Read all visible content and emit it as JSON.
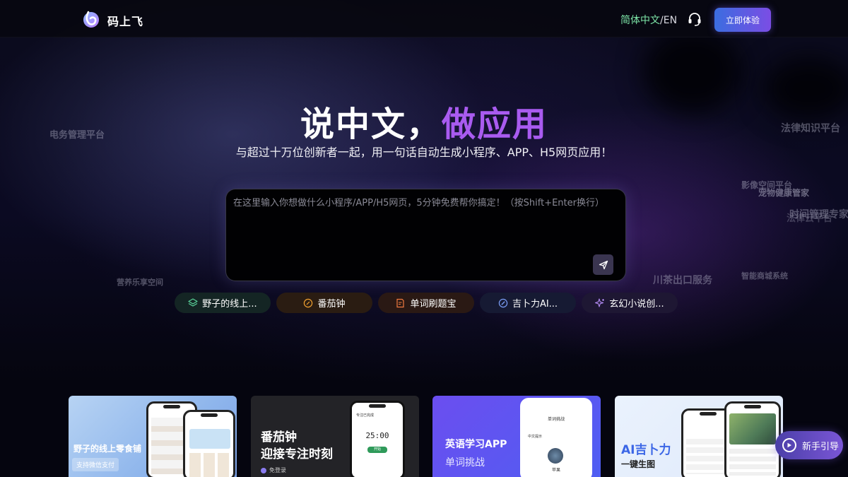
{
  "header": {
    "brand": "码上飞",
    "lang_cn": "简体中文",
    "lang_sep": "/",
    "lang_en": "EN",
    "try_label": "立即体验"
  },
  "hero": {
    "title_main": "说中文，",
    "title_highlight": "做应用",
    "subtitle": "与超过十万位创新者一起，用一句话自动生成小程序、APP、H5网页应用！"
  },
  "floaters": [
    "电务管理平台",
    "法律知识平台",
    "影像空间平台",
    "宠物健康管家",
    "时间管理专家",
    "法律云平台",
    "营养乐享空间",
    "川茶出口服务",
    "智能商城系统"
  ],
  "prompt": {
    "placeholder": "在这里输入你想做什么小程序/APP/H5网页，5分钟免费帮你搞定！（按Shift+Enter换行）"
  },
  "chips": [
    {
      "label": "野子的线上...",
      "icon": "layers-icon",
      "color": "#5ad39a"
    },
    {
      "label": "番茄钟",
      "icon": "clock-link-icon",
      "color": "#f0a030"
    },
    {
      "label": "单词刷题宝",
      "icon": "edit-doc-icon",
      "color": "#f07a40"
    },
    {
      "label": "吉卜力AI...",
      "icon": "compass-icon",
      "color": "#7a9cf5"
    },
    {
      "label": "玄幻小说创...",
      "icon": "sparkle-icon",
      "color": "#b48cf5"
    }
  ],
  "cards": [
    {
      "title": "野子的线上零食铺",
      "badge": "支持微信支付"
    },
    {
      "title_line1": "番茄钟",
      "title_line2": "迎接专注时刻",
      "footer": "免登录",
      "timer": "25:00",
      "status": "专注已完成",
      "start": "开始"
    },
    {
      "title_line1": "英语学习APP",
      "title_line2": "单词挑战",
      "screen_title": "单词挑战",
      "prompt": "中文提示",
      "word": "苹果"
    },
    {
      "title_line1": "AI吉卜力",
      "title_line2": "一键生图"
    }
  ],
  "guide": {
    "label": "新手引导"
  }
}
